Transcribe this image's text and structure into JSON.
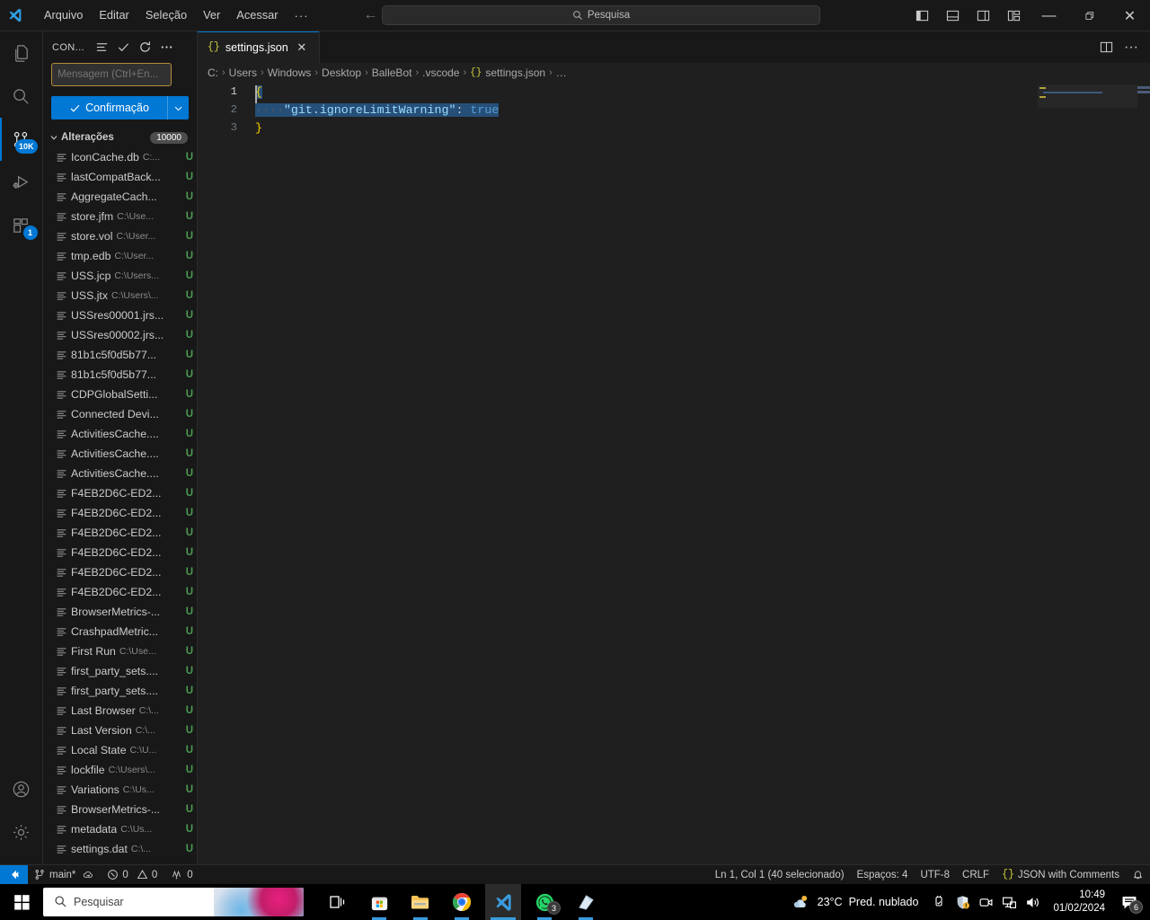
{
  "titlebar": {
    "menu_items": [
      "Arquivo",
      "Editar",
      "Seleção",
      "Ver",
      "Acessar"
    ],
    "menu_overflow": "···",
    "search_placeholder": "Pesquisa",
    "back_arrow": "←",
    "forward_arrow": "→",
    "minimize": "—",
    "restore": "❐",
    "close": "✕"
  },
  "activitybar": {
    "items": [
      {
        "name": "explorer",
        "badge": ""
      },
      {
        "name": "search",
        "badge": ""
      },
      {
        "name": "source-control",
        "badge": "10K"
      },
      {
        "name": "run-and-debug",
        "badge": ""
      },
      {
        "name": "extensions",
        "badge": "1"
      }
    ],
    "account": "account-icon",
    "settings": "gear-icon"
  },
  "sidebar": {
    "title": "CON...",
    "actions": [
      "view-as-list-icon",
      "commit-check-icon",
      "refresh-icon",
      "more-actions-icon"
    ],
    "commit_message_placeholder": "Mensagem (Ctrl+En...",
    "commit_message_value": "",
    "commit_button": "Confirmação",
    "commit_dropdown": "⌄",
    "changes_label": "Alterações",
    "changes_count": "10000",
    "files": [
      {
        "name": "IconCache.db",
        "path": "C:...",
        "status": "U"
      },
      {
        "name": "lastCompatBack...",
        "path": "",
        "status": "U"
      },
      {
        "name": "AggregateCach...",
        "path": "",
        "status": "U"
      },
      {
        "name": "store.jfm",
        "path": "C:\\Use...",
        "status": "U"
      },
      {
        "name": "store.vol",
        "path": "C:\\User...",
        "status": "U"
      },
      {
        "name": "tmp.edb",
        "path": "C:\\User...",
        "status": "U"
      },
      {
        "name": "USS.jcp",
        "path": "C:\\Users...",
        "status": "U"
      },
      {
        "name": "USS.jtx",
        "path": "C:\\Users\\...",
        "status": "U"
      },
      {
        "name": "USSres00001.jrs...",
        "path": "",
        "status": "U"
      },
      {
        "name": "USSres00002.jrs...",
        "path": "",
        "status": "U"
      },
      {
        "name": "81b1c5f0d5b77...",
        "path": "",
        "status": "U"
      },
      {
        "name": "81b1c5f0d5b77...",
        "path": "",
        "status": "U"
      },
      {
        "name": "CDPGlobalSetti...",
        "path": "",
        "status": "U"
      },
      {
        "name": "Connected Devi...",
        "path": "",
        "status": "U"
      },
      {
        "name": "ActivitiesCache....",
        "path": "",
        "status": "U"
      },
      {
        "name": "ActivitiesCache....",
        "path": "",
        "status": "U"
      },
      {
        "name": "ActivitiesCache....",
        "path": "",
        "status": "U"
      },
      {
        "name": "F4EB2D6C-ED2...",
        "path": "",
        "status": "U"
      },
      {
        "name": "F4EB2D6C-ED2...",
        "path": "",
        "status": "U"
      },
      {
        "name": "F4EB2D6C-ED2...",
        "path": "",
        "status": "U"
      },
      {
        "name": "F4EB2D6C-ED2...",
        "path": "",
        "status": "U"
      },
      {
        "name": "F4EB2D6C-ED2...",
        "path": "",
        "status": "U"
      },
      {
        "name": "F4EB2D6C-ED2...",
        "path": "",
        "status": "U"
      },
      {
        "name": "BrowserMetrics-...",
        "path": "",
        "status": "U"
      },
      {
        "name": "CrashpadMetric...",
        "path": "",
        "status": "U"
      },
      {
        "name": "First Run",
        "path": "C:\\Use...",
        "status": "U"
      },
      {
        "name": "first_party_sets....",
        "path": "",
        "status": "U"
      },
      {
        "name": "first_party_sets....",
        "path": "",
        "status": "U"
      },
      {
        "name": "Last Browser",
        "path": "C:\\...",
        "status": "U"
      },
      {
        "name": "Last Version",
        "path": "C:\\...",
        "status": "U"
      },
      {
        "name": "Local State",
        "path": "C:\\U...",
        "status": "U"
      },
      {
        "name": "lockfile",
        "path": "C:\\Users\\...",
        "status": "U"
      },
      {
        "name": "Variations",
        "path": "C:\\Us...",
        "status": "U"
      },
      {
        "name": "BrowserMetrics-...",
        "path": "",
        "status": "U"
      },
      {
        "name": "metadata",
        "path": "C:\\Us...",
        "status": "U"
      },
      {
        "name": "settings.dat",
        "path": "C:\\...",
        "status": "U"
      }
    ]
  },
  "editor": {
    "tab_label": "settings.json",
    "tab_icon": "{}",
    "tab_close": "✕",
    "split_editor": "split-editor-icon",
    "more_actions": "···",
    "breadcrumb": [
      "C:",
      "Users",
      "Windows",
      "Desktop",
      "BalleBot",
      ".vscode",
      "settings.json",
      "…"
    ],
    "breadcrumb_sep": "›",
    "lines": [
      {
        "number": "1",
        "text": "{"
      },
      {
        "number": "2",
        "text": "    \"git.ignoreLimitWarning\": true"
      },
      {
        "number": "3",
        "text": "}"
      }
    ],
    "line1_brace": "{",
    "line2_indent": "····",
    "line2_key": "\"git.ignoreLimitWarning\"",
    "line2_colon": ":",
    "line2_value": "true",
    "line3_brace": "}"
  },
  "statusbar": {
    "remote_icon": "remote-window-icon",
    "branch": "main*",
    "sync_icon": "sync-cloud-icon",
    "errors": "0",
    "warnings": "0",
    "ports": "0",
    "cursor_position": "Ln 1, Col 1 (40 selecionado)",
    "indentation": "Espaços: 4",
    "encoding": "UTF-8",
    "eol": "CRLF",
    "language_icon": "{}",
    "language": "JSON with Comments",
    "bell": "bell-icon"
  },
  "taskbar": {
    "start": "windows-start-icon",
    "search_placeholder": "Pesquisar",
    "apps": [
      {
        "name": "task-view",
        "badge": ""
      },
      {
        "name": "microsoft-store",
        "badge": ""
      },
      {
        "name": "file-explorer",
        "badge": ""
      },
      {
        "name": "google-chrome",
        "badge": ""
      },
      {
        "name": "visual-studio-code",
        "badge": ""
      },
      {
        "name": "whatsapp",
        "badge": "3"
      },
      {
        "name": "sticky-notes",
        "badge": ""
      }
    ],
    "weather_temp": "23°C",
    "weather_desc": "Pred. nublado",
    "tray_icons": [
      "usb-icon",
      "security-shield-icon",
      "camera-icon",
      "network-icon",
      "volume-icon"
    ],
    "time": "10:49",
    "date": "01/02/2024",
    "notification_count": "6"
  },
  "colors": {
    "accent": "#0078d4",
    "selection": "#264f78",
    "added": "#4c9a52",
    "brace": "#ffd700",
    "key": "#9cdcfe",
    "bool": "#569cd6"
  }
}
